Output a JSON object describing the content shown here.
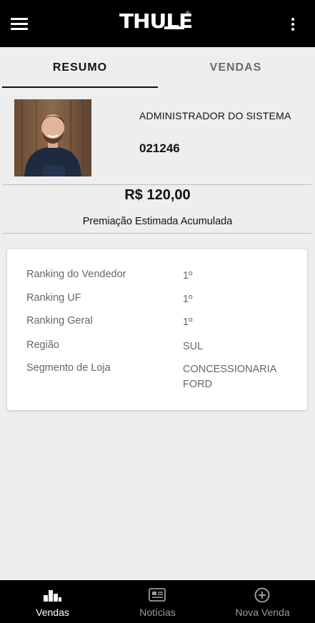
{
  "header": {
    "logo_text": "THULE",
    "menu_icon": "hamburger-menu-icon",
    "more_icon": "more-vertical-icon"
  },
  "tabs": [
    {
      "label": "RESUMO",
      "active": true
    },
    {
      "label": "VENDAS",
      "active": false
    }
  ],
  "profile": {
    "name": "ADMINISTRADOR DO SISTEMA",
    "code": "021246"
  },
  "summary": {
    "amount": "R$ 120,00",
    "caption": "Premiação Estimada Acumulada"
  },
  "details": [
    {
      "label": "Ranking do Vendedor",
      "value": "1º"
    },
    {
      "label": "Ranking UF",
      "value": "1º"
    },
    {
      "label": "Ranking Geral",
      "value": "1º"
    },
    {
      "label": "Região",
      "value": "SUL"
    },
    {
      "label": "Segmento de Loja",
      "value": "CONCESSIONARIA FORD"
    }
  ],
  "bottom_nav": [
    {
      "label": "Vendas",
      "icon": "bar-chart-icon",
      "active": true
    },
    {
      "label": "Notícias",
      "icon": "newspaper-icon",
      "active": false
    },
    {
      "label": "Nova Venda",
      "icon": "add-circle-icon",
      "active": false
    }
  ],
  "colors": {
    "bar_background": "#000000",
    "page_background": "#eeeeee",
    "card_background": "#ffffff",
    "muted_text": "#666666"
  }
}
